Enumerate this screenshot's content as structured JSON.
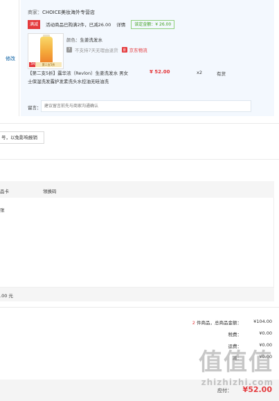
{
  "left": {
    "modify_label": "修改"
  },
  "shop": {
    "label": "商家：",
    "name": "CHOICE美妆海外专营店"
  },
  "promo": {
    "tag": "满减",
    "text": "活动商品已购满2件，已减26.00",
    "details_label": "详情",
    "saved_label": "该定金额：",
    "saved_amount": "¥ 26.00"
  },
  "product": {
    "image_badge": "34",
    "image_strip": "第二支5折",
    "color_key": "颜色：",
    "color_value": "生姜洗发水",
    "service_text": "不支持7天无理由退货",
    "jd_logistics": "京东物流",
    "name": "【第二支5折】露华浓（Revlon）生姜洗发水 男女士保湿洗发露护发素洗头水控油无硅油洗",
    "price": "¥ 52.00",
    "qty": "x2",
    "stock": "有货"
  },
  "remark": {
    "label": "留言：",
    "placeholder": "建议留言前先与商家沟通确认"
  },
  "invoice": {
    "button_label": "号，以免影响报销"
  },
  "table": {
    "headers": [
      "品卡",
      "领换码"
    ],
    "row_cell": "张",
    "footer_amount": ".00 元"
  },
  "summary": [
    {
      "label": "件商品，总商品金额：",
      "count": "2",
      "value": "¥104.00"
    },
    {
      "label": "税费：",
      "value": "¥0.00"
    },
    {
      "label": "运费：",
      "value": "¥0.00"
    },
    {
      "label": "减：",
      "value": "¥0.00"
    },
    {
      "label": "",
      "value": ""
    }
  ],
  "bottom": {
    "pay_label": "应付：",
    "pay_amount": "¥52.00"
  },
  "watermark": {
    "glyphs": "值值值",
    "text": "zhizhizhi.com"
  },
  "colors": {
    "accent": "#e4393c",
    "link": "#005aa0",
    "card_bg": "#f3f8fe",
    "saved_green": "#3d9e1d"
  }
}
